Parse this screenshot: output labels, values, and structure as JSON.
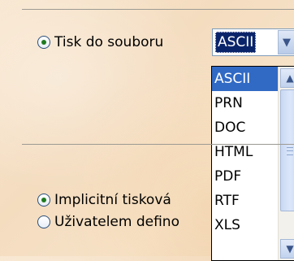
{
  "print_to_file": {
    "label": "Tisk do souboru",
    "checked": true
  },
  "format_select": {
    "value": "ASCII",
    "options": [
      {
        "label": "ASCII",
        "selected": true
      },
      {
        "label": "PRN"
      },
      {
        "label": "DOC"
      },
      {
        "label": "HTML"
      },
      {
        "label": "PDF"
      },
      {
        "label": "RTF"
      },
      {
        "label": "XLS"
      }
    ]
  },
  "default_printer": {
    "label": "Implicitní tisková",
    "checked": true
  },
  "user_defined": {
    "label": "Uživatelem defino",
    "checked": false
  },
  "icons": {
    "dropdown_arrow": "chevron-down-icon",
    "scroll_up": "chevron-up-icon",
    "scroll_down": "chevron-down-icon"
  }
}
